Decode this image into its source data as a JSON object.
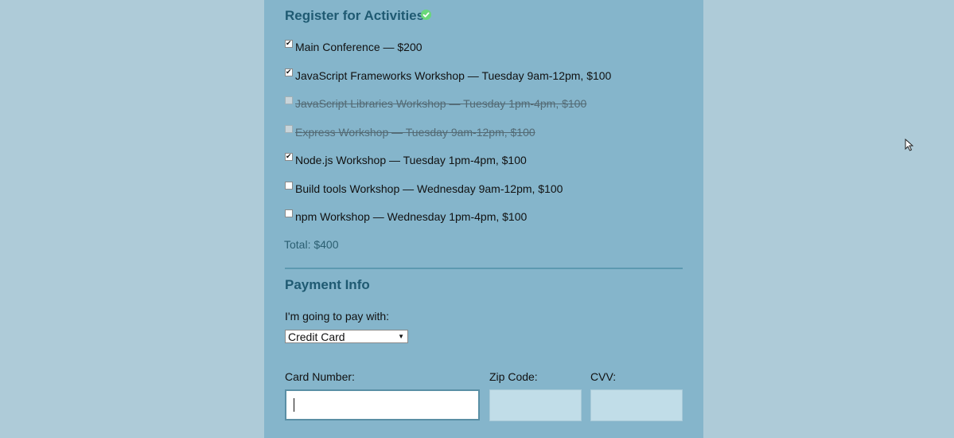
{
  "activities_section": {
    "title": "Register for Activities",
    "valid_icon": "check-circle-icon",
    "items": [
      {
        "label": "Main Conference — $200",
        "checked": true,
        "disabled": false
      },
      {
        "label": "JavaScript Frameworks Workshop — Tuesday 9am-12pm, $100",
        "checked": true,
        "disabled": false
      },
      {
        "label": "JavaScript Libraries Workshop — Tuesday 1pm-4pm, $100",
        "checked": false,
        "disabled": true
      },
      {
        "label": "Express Workshop — Tuesday 9am-12pm, $100",
        "checked": false,
        "disabled": true
      },
      {
        "label": "Node.js Workshop — Tuesday 1pm-4pm, $100",
        "checked": true,
        "disabled": false
      },
      {
        "label": "Build tools Workshop — Wednesday 9am-12pm, $100",
        "checked": false,
        "disabled": false
      },
      {
        "label": "npm Workshop — Wednesday 1pm-4pm, $100",
        "checked": false,
        "disabled": false
      }
    ],
    "total": "Total: $400"
  },
  "payment_section": {
    "title": "Payment Info",
    "pay_with_label": "I'm going to pay with:",
    "payment_method": "Credit Card",
    "card_number_label": "Card Number:",
    "card_number_value": "",
    "zip_label": "Zip Code:",
    "zip_value": "",
    "cvv_label": "CVV:",
    "cvv_value": ""
  },
  "colors": {
    "page_background": "#aecbd8",
    "panel_background": "#85b5cb",
    "heading": "#1f5a72",
    "valid_green": "#69d77a",
    "input_background": "#c1dde8"
  }
}
